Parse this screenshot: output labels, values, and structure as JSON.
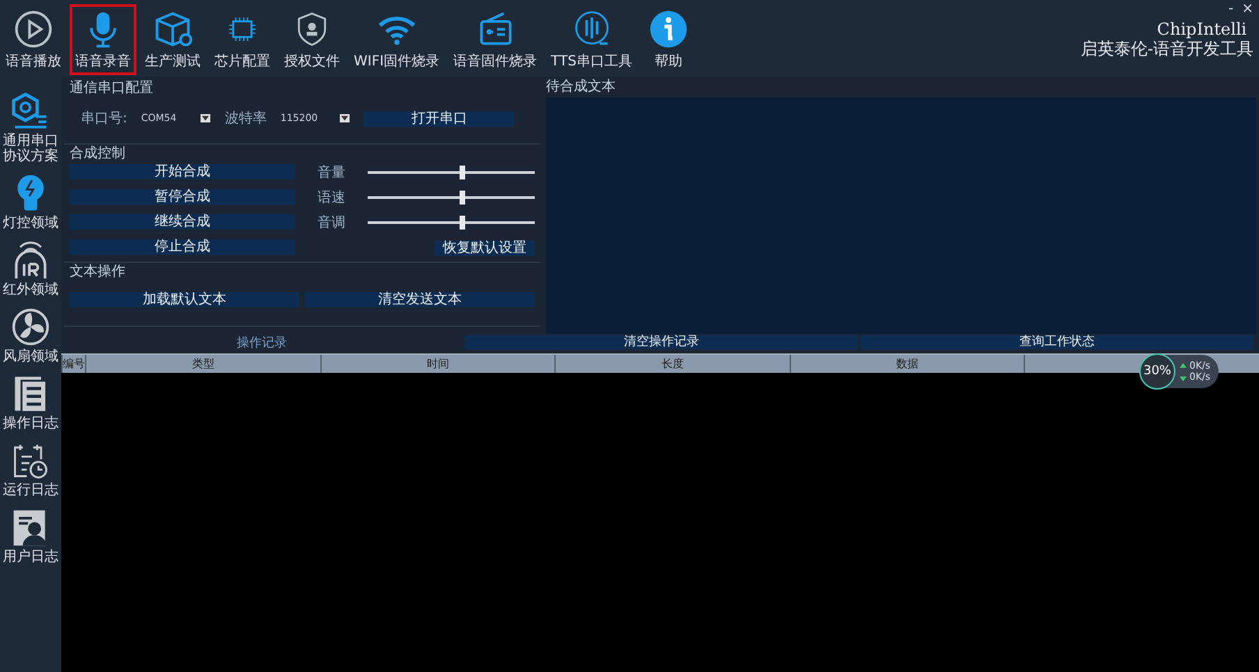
{
  "toolbar": [
    {
      "label": "语音播放",
      "selected": false
    },
    {
      "label": "语音录音",
      "selected": true
    },
    {
      "label": "生产测试",
      "selected": false
    },
    {
      "label": "芯片配置",
      "selected": false
    },
    {
      "label": "授权文件",
      "selected": false
    },
    {
      "label": "WIFI固件烧录",
      "selected": false
    },
    {
      "label": "语音固件烧录",
      "selected": false
    },
    {
      "label": "TTS串口工具",
      "selected": false
    },
    {
      "label": "帮助",
      "selected": false
    }
  ],
  "window_controls": [
    "-",
    "×"
  ],
  "brand": {
    "name": "ChipIntelli",
    "subtitle": "启英泰伦-语音开发工具"
  },
  "sidebar": [
    {
      "label": "通用串口协议方案"
    },
    {
      "label": "灯控领域"
    },
    {
      "label": "红外领域"
    },
    {
      "label": "风扇领域"
    },
    {
      "label": "操作日志"
    },
    {
      "label": "运行日志"
    },
    {
      "label": "用户日志"
    }
  ],
  "serial": {
    "title": "通信串口配置",
    "port_label": "串口号:",
    "port": "COM54",
    "baud_label": "波特率",
    "baud": "115200",
    "open_button": "打开串口"
  },
  "synthesis": {
    "title": "合成控制",
    "buttons": [
      "开始合成",
      "暂停合成",
      "继续合成",
      "停止合成"
    ],
    "sliders": [
      {
        "label": "音量",
        "level": 0.57
      },
      {
        "label": "语速",
        "level": 0.57
      },
      {
        "label": "音调",
        "level": 0.57
      }
    ],
    "reset_button": "恢复默认设置"
  },
  "text_ops": {
    "title": "文本操作",
    "buttons": [
      "加载默认文本",
      "清空发送文本"
    ]
  },
  "pending_text": {
    "title": "待合成文本"
  },
  "log": {
    "tab": "操作记录",
    "buttons": [
      "清空操作记录",
      "查询工作状态"
    ],
    "columns": [
      "编号",
      "类型",
      "时间",
      "长度",
      "数据"
    ]
  },
  "speed_widget": {
    "percent": "30%",
    "upload": "0K/s",
    "download": "0K/s"
  }
}
